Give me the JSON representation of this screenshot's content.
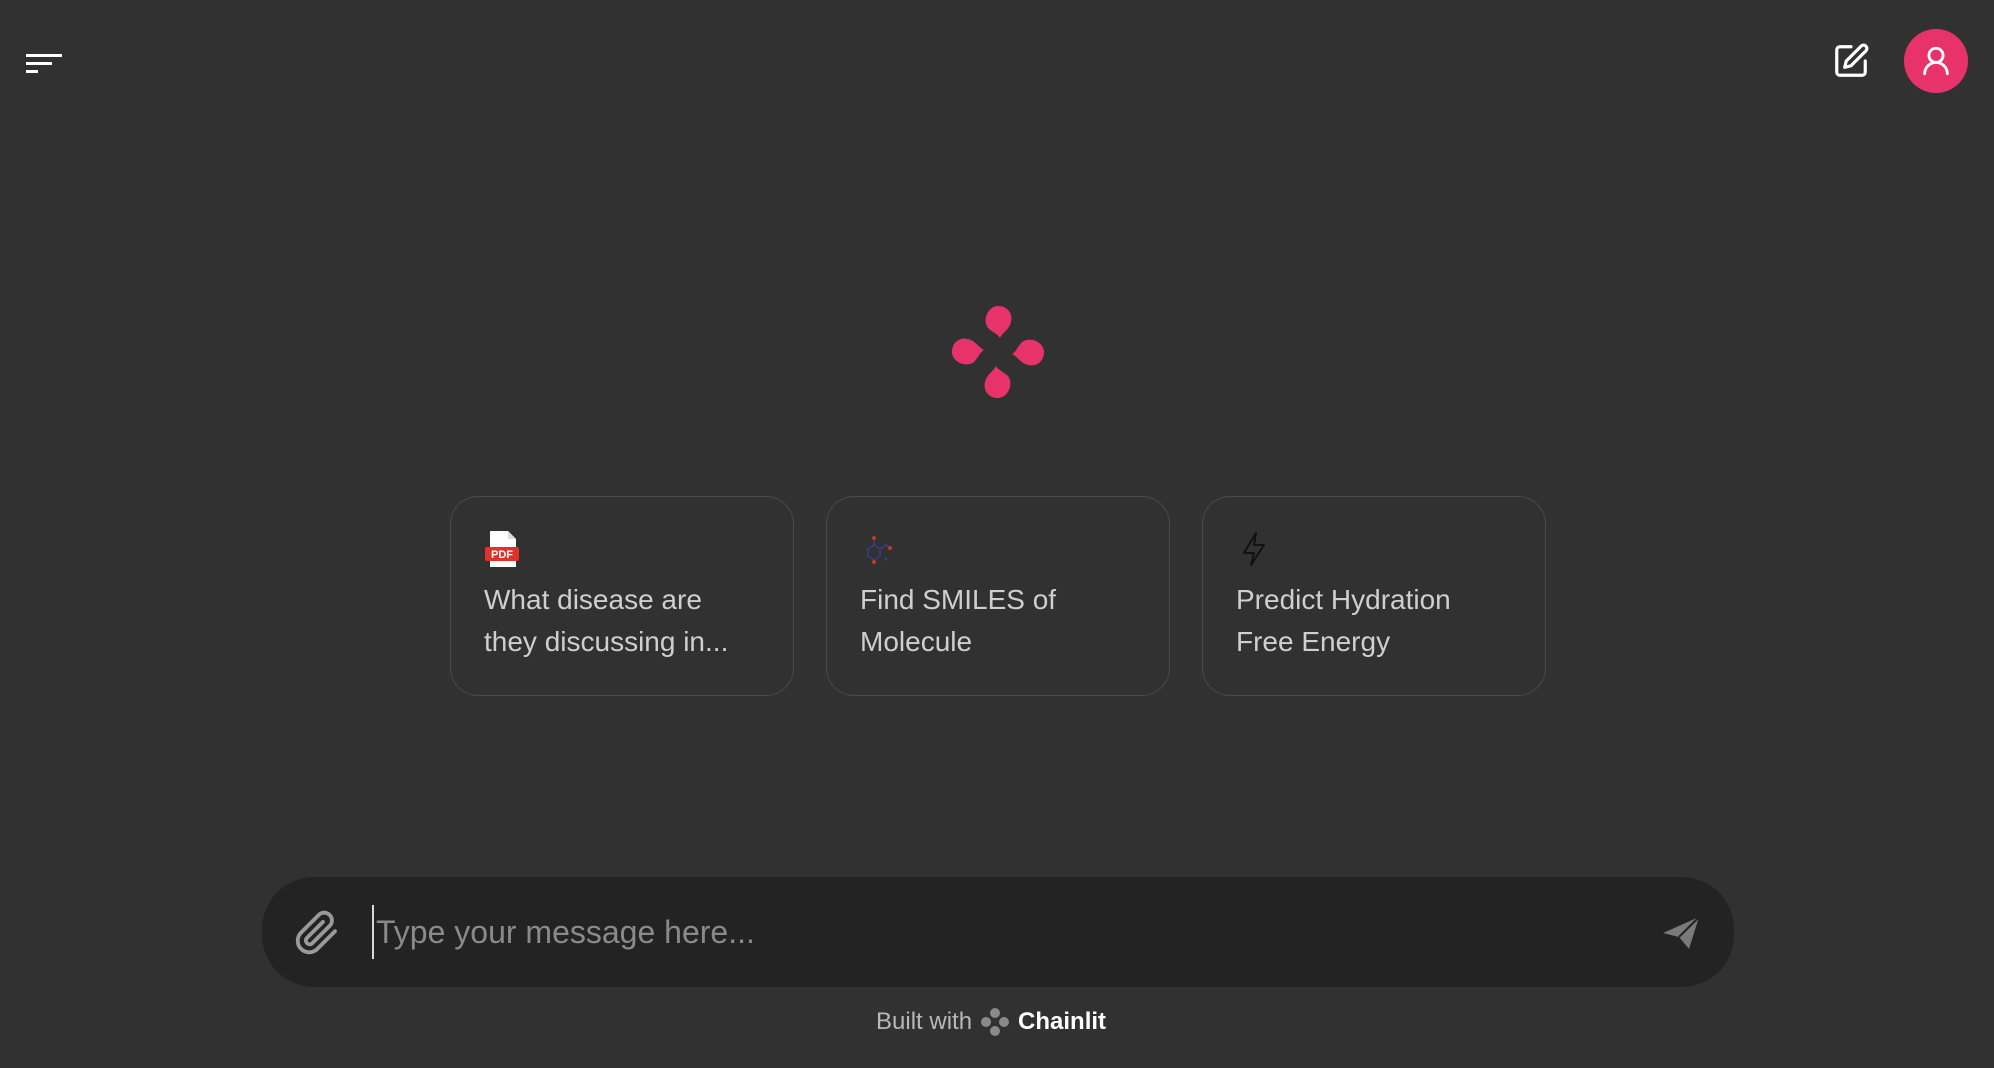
{
  "header": {
    "menu_icon": "menu-lines-icon",
    "new_chat_icon": "edit-square-icon",
    "user_icon": "user-icon"
  },
  "brand": {
    "accent_color": "#e8336a",
    "logo_icon": "chainlit-logo-icon"
  },
  "starters": [
    {
      "icon": "pdf-file-icon",
      "label": "What disease are they discussing in..."
    },
    {
      "icon": "molecule-icon",
      "label": "Find SMILES of Molecule"
    },
    {
      "icon": "lightning-icon",
      "label": "Predict Hydration Free Energy"
    }
  ],
  "composer": {
    "placeholder": "Type your message here...",
    "value": "",
    "attach_icon": "paperclip-icon",
    "send_icon": "send-icon"
  },
  "footer": {
    "built_with": "Built with",
    "brand_name": "Chainlit"
  }
}
